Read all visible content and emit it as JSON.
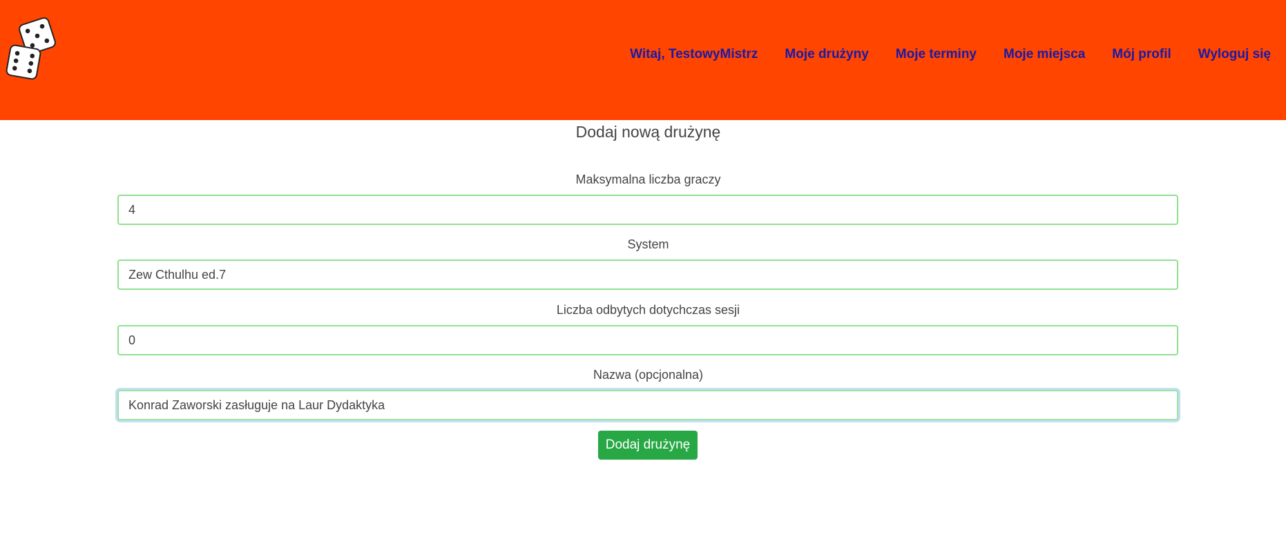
{
  "nav": {
    "logo_icon": "dice-logo-icon",
    "links": [
      {
        "label": "Witaj, TestowyMistrz"
      },
      {
        "label": "Moje drużyny"
      },
      {
        "label": "Moje terminy"
      },
      {
        "label": "Moje miejsca"
      },
      {
        "label": "Mój profil"
      },
      {
        "label": "Wyloguj się"
      }
    ]
  },
  "form": {
    "title": "Dodaj nową drużynę",
    "fields": [
      {
        "label": "Maksymalna liczba graczy",
        "value": "4"
      },
      {
        "label": "System",
        "value": "Zew Cthulhu ed.7"
      },
      {
        "label": "Liczba odbytych dotychczas sesji",
        "value": "0"
      },
      {
        "label": "Nazwa (opcjonalna)",
        "value": "Konrad Zaworski zasługuje na Laur Dydaktyka"
      }
    ],
    "submit_label": "Dodaj drużynę"
  },
  "colors": {
    "navbar": "#ff4500",
    "nav_link": "#1a1aa6",
    "input_border": "#8fe08f",
    "submit": "#28a745"
  }
}
